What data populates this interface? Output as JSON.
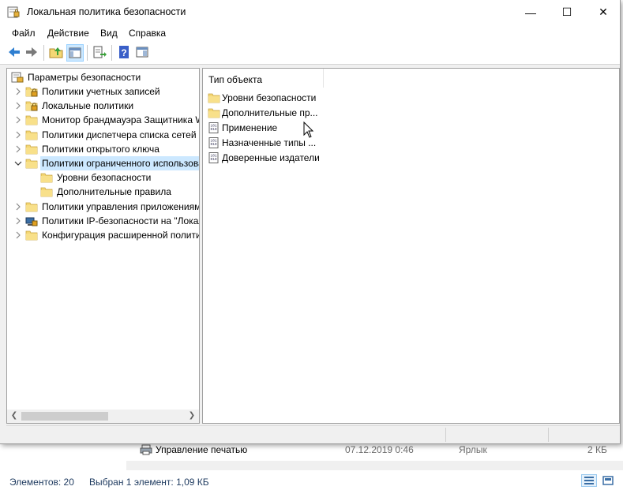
{
  "window": {
    "title": "Локальная политика безопасности",
    "minimize_glyph": "—",
    "maximize_glyph": "☐",
    "close_glyph": "✕"
  },
  "menu": [
    "Файл",
    "Действие",
    "Вид",
    "Справка"
  ],
  "tree": {
    "root_label": "Параметры безопасности",
    "items": [
      {
        "label": "Политики учетных записей",
        "icon": "locked-folder-icon",
        "expanded": false
      },
      {
        "label": "Локальные политики",
        "icon": "locked-folder-icon",
        "expanded": false
      },
      {
        "label": "Монитор брандмауэра Защитника Windows",
        "icon": "folder-icon",
        "expanded": false
      },
      {
        "label": "Политики диспетчера списка сетей",
        "icon": "folder-icon",
        "expanded": false
      },
      {
        "label": "Политики открытого ключа",
        "icon": "folder-icon",
        "expanded": false
      },
      {
        "label": "Политики ограниченного использования программ",
        "icon": "folder-icon",
        "expanded": true,
        "selected": true
      },
      {
        "label": "Уровни безопасности",
        "icon": "folder-icon",
        "child": true
      },
      {
        "label": "Дополнительные правила",
        "icon": "folder-icon",
        "child": true
      },
      {
        "label": "Политики управления приложениями",
        "icon": "folder-icon",
        "expanded": false
      },
      {
        "label": "Политики IP-безопасности на \"Локальный компьютер\"",
        "icon": "ip-security-icon",
        "expanded": false
      },
      {
        "label": "Конфигурация расширенной политики аудита",
        "icon": "folder-icon",
        "expanded": false
      }
    ]
  },
  "content": {
    "column_header": "Тип объекта",
    "items": [
      {
        "label": "Уровни безопасности",
        "icon": "folder-icon"
      },
      {
        "label": "Дополнительные пр...",
        "icon": "folder-icon"
      },
      {
        "label": "Применение",
        "icon": "policy-document-icon"
      },
      {
        "label": "Назначенные типы ...",
        "icon": "policy-document-icon"
      },
      {
        "label": "Доверенные издатели",
        "icon": "policy-document-icon"
      }
    ]
  },
  "background_explorer": {
    "row": {
      "name": "Управление печатью",
      "date": "07.12.2019 0:46",
      "type": "Ярлык",
      "size": "2 КБ"
    },
    "status_count": "Элементов: 20",
    "status_selected": "Выбран 1 элемент: 1,09 КБ"
  },
  "colors": {
    "selection": "#cce8ff",
    "folder": "#f4d774",
    "folder_dark": "#dcb44a"
  }
}
